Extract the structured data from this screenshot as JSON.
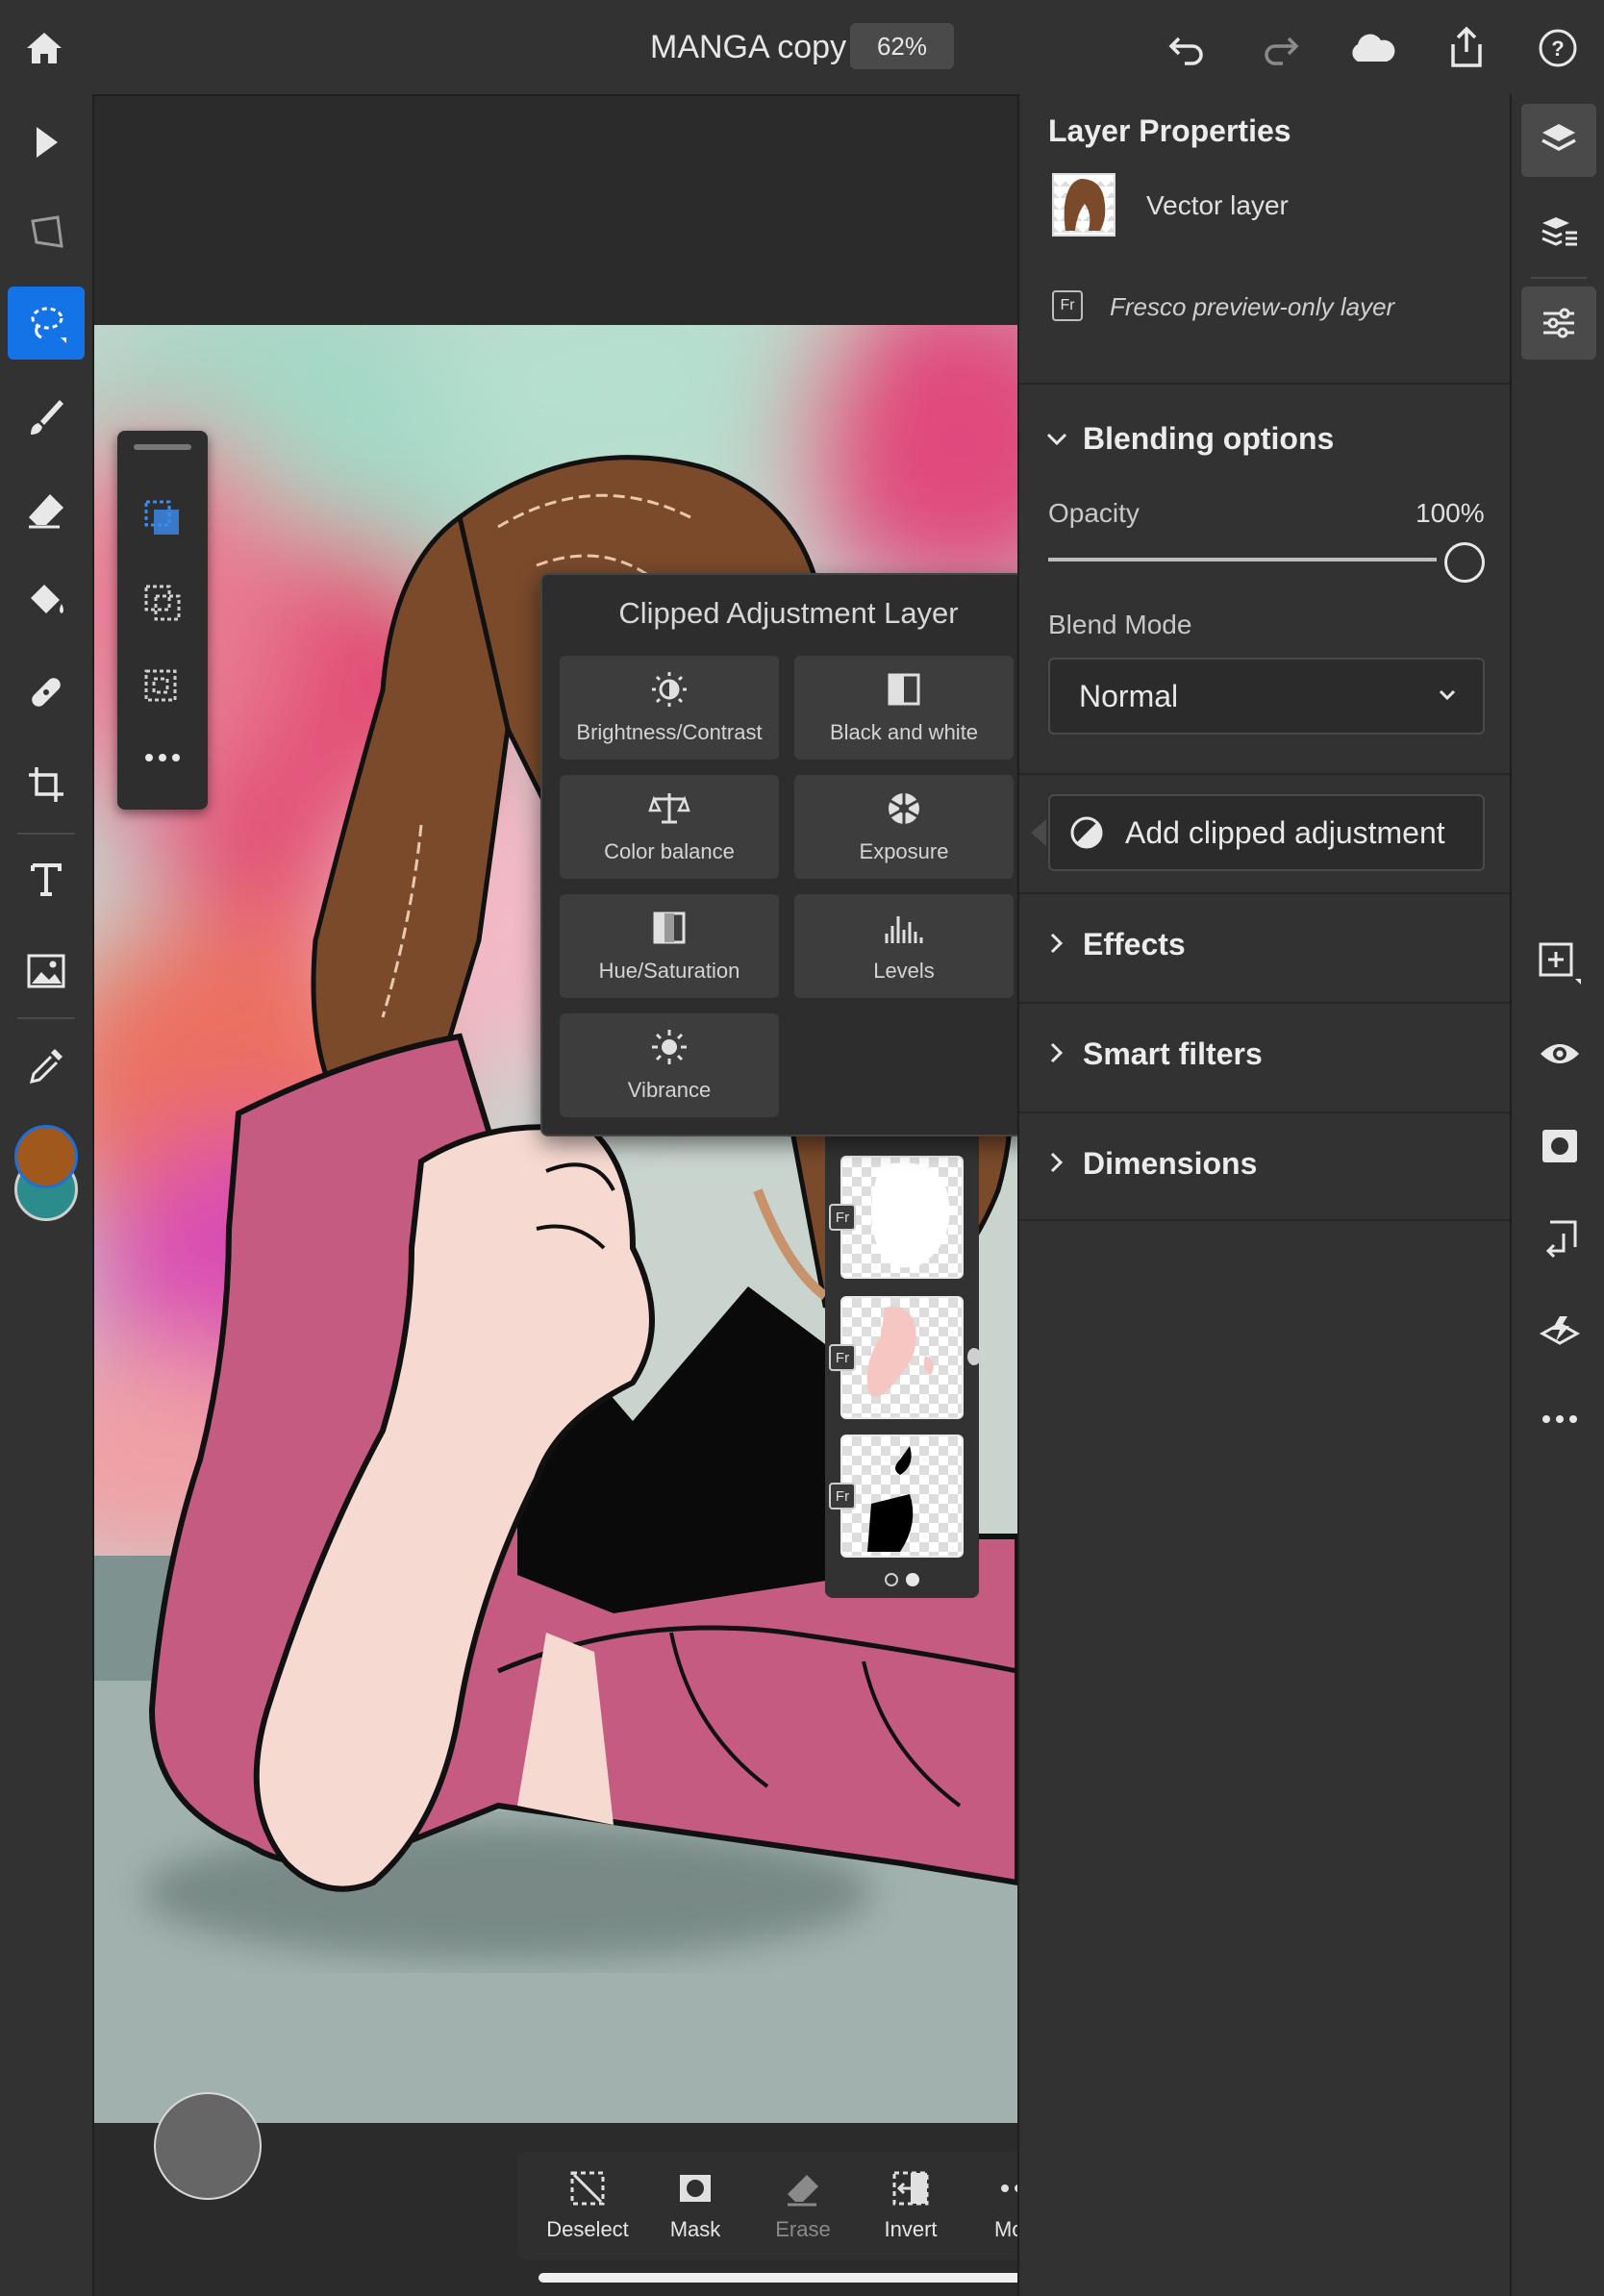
{
  "header": {
    "doc_title": "MANGA copy",
    "zoom": "62%"
  },
  "layer_props": {
    "heading": "Layer Properties",
    "layer_type": "Vector layer",
    "fresco_note": "Fresco preview-only layer",
    "fr_badge": "Fr"
  },
  "blending": {
    "heading": "Blending options",
    "opacity_label": "Opacity",
    "opacity_value": "100%",
    "opacity_fraction": 1.0,
    "blend_mode_label": "Blend Mode",
    "blend_mode_value": "Normal"
  },
  "add_clipped": "Add clipped adjustment",
  "sections": {
    "effects": "Effects",
    "smart_filters": "Smart filters",
    "dimensions": "Dimensions"
  },
  "popup": {
    "title": "Clipped Adjustment Layer",
    "items": [
      {
        "label": "Brightness/Contrast",
        "icon": "brightness-icon"
      },
      {
        "label": "Black and white",
        "icon": "black-white-icon"
      },
      {
        "label": "Color balance",
        "icon": "balance-scale-icon"
      },
      {
        "label": "Exposure",
        "icon": "aperture-icon"
      },
      {
        "label": "Hue/Saturation",
        "icon": "hue-saturation-icon"
      },
      {
        "label": "Levels",
        "icon": "histogram-icon"
      },
      {
        "label": "Vibrance",
        "icon": "vibrance-icon"
      }
    ]
  },
  "layer_badges": [
    "Fr",
    "Fr",
    "Fr"
  ],
  "bottom_bar": {
    "deselect": "Deselect",
    "mask": "Mask",
    "erase": "Erase",
    "invert": "Invert",
    "more": "More"
  },
  "colors": {
    "accent": "#1473e6",
    "primary_swatch": "#a0581c",
    "secondary_swatch": "#2c8c8c",
    "panel_bg": "#323232"
  }
}
